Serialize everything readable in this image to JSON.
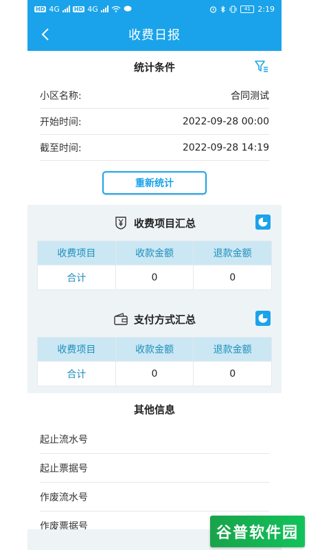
{
  "status": {
    "left_chip1": "HD",
    "left_chip2": "HD",
    "network1": "4G",
    "network2": "4G",
    "battery": "41",
    "time": "2:19"
  },
  "header": {
    "title": "收费日报"
  },
  "conditions": {
    "title": "统计条件",
    "rows": [
      {
        "label": "小区名称:",
        "value": "合同测试"
      },
      {
        "label": "开始时间:",
        "value": "2022-09-28 00:00"
      },
      {
        "label": "截至时间:",
        "value": "2022-09-28 14:19"
      }
    ],
    "recount_label": "重新统计"
  },
  "fee_summary": {
    "title": "收费项目汇总",
    "headers": [
      "收费项目",
      "收款金额",
      "退款金额"
    ],
    "row": [
      "合计",
      "0",
      "0"
    ]
  },
  "payment_summary": {
    "title": "支付方式汇总",
    "headers": [
      "收费项目",
      "收款金额",
      "退款金额"
    ],
    "row": [
      "合计",
      "0",
      "0"
    ]
  },
  "other": {
    "title": "其他信息",
    "items": [
      "起止流水号",
      "起止票据号",
      "作废流水号",
      "作废票据号"
    ]
  },
  "watermark": "谷普软件园",
  "colors": {
    "primary": "#1aa3ea",
    "table_header_bg": "#cbe7f3",
    "table_header_text": "#1d8fbd",
    "summary_bg": "#eef3f6"
  }
}
